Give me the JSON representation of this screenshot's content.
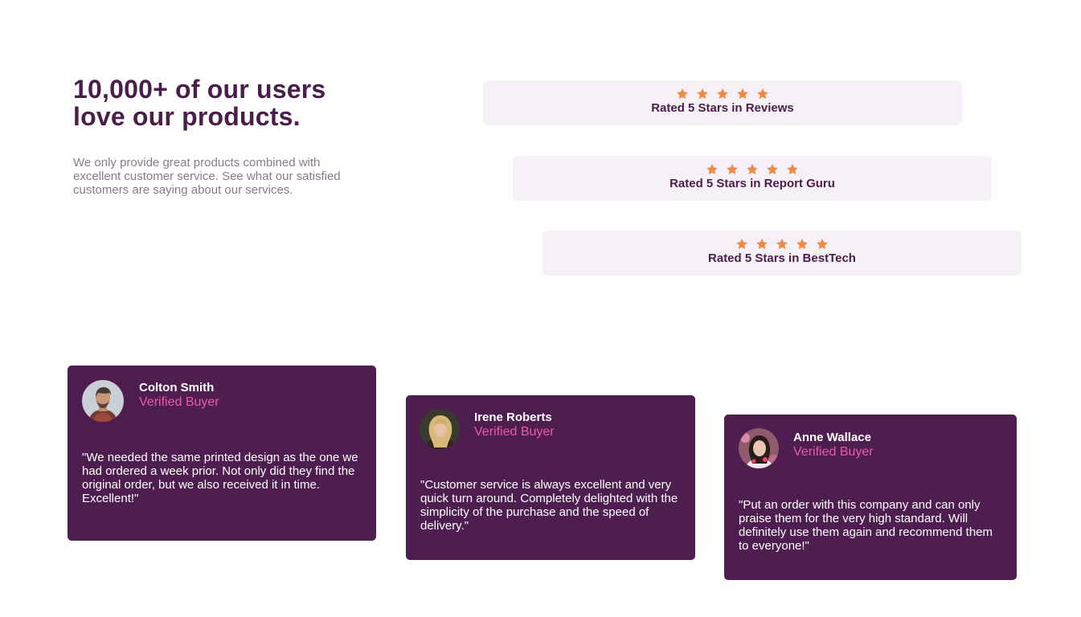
{
  "hero": {
    "headline": "10,000+ of our users love our products.",
    "intro": "We only provide great products combined with excellent customer service. See what our satisfied customers are saying about our services."
  },
  "ratings": [
    {
      "label": "Rated 5 Stars in Reviews",
      "stars": 5
    },
    {
      "label": "Rated 5 Stars in Report Guru",
      "stars": 5
    },
    {
      "label": "Rated 5 Stars in BestTech",
      "stars": 5
    }
  ],
  "testimonials": [
    {
      "name": "Colton Smith",
      "role": "Verified Buyer",
      "quote": "\"We needed the same printed design as the one we had ordered a week prior. Not only did they find the original order, but we also received it in time. Excellent!\""
    },
    {
      "name": "Irene Roberts",
      "role": "Verified Buyer",
      "quote": "\"Customer service is always excellent and very quick turn around. Completely delighted with the simplicity of the purchase and the speed of delivery.\""
    },
    {
      "name": "Anne Wallace",
      "role": "Verified Buyer",
      "quote": "\"Put an order with this company and can only praise them for the very high standard. Will definitely use them again and recommend them to everyone!\""
    }
  ],
  "colors": {
    "primary": "#4f1e50",
    "accent_pink": "#ec5aa5",
    "star": "#ee8b43",
    "rating_bg": "#f6f0f7"
  }
}
